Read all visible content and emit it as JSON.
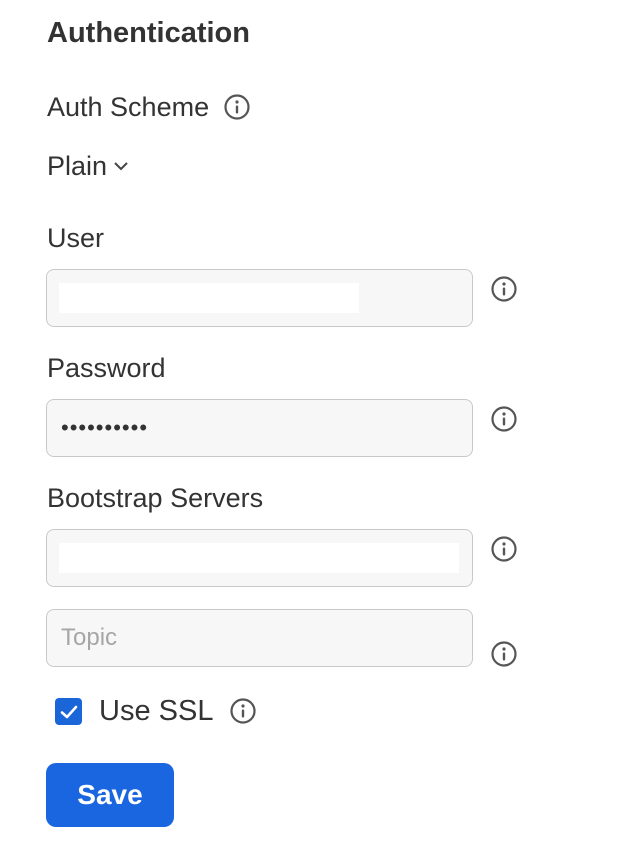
{
  "section": {
    "title": "Authentication"
  },
  "auth_scheme": {
    "label": "Auth Scheme",
    "value": "Plain",
    "icon": "chevron-down-icon"
  },
  "user": {
    "label": "User",
    "value": ""
  },
  "password": {
    "label": "Password",
    "value": "••••••••••"
  },
  "bootstrap": {
    "label": "Bootstrap Servers",
    "value": ""
  },
  "topic": {
    "placeholder": "Topic",
    "value": ""
  },
  "ssl": {
    "label": "Use SSL",
    "checked": true
  },
  "actions": {
    "save_label": "Save"
  },
  "colors": {
    "accent": "#1a66e0",
    "field_bg": "#f7f7f7",
    "field_border": "#c9c9c9",
    "text": "#333333"
  }
}
